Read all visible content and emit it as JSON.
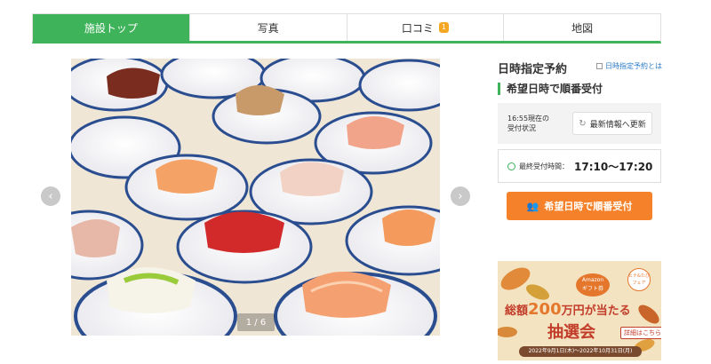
{
  "tabs": [
    {
      "label": "施設トップ",
      "active": true
    },
    {
      "label": "写真",
      "active": false
    },
    {
      "label": "口コミ",
      "badge": "1",
      "active": false
    },
    {
      "label": "地図",
      "active": false
    }
  ],
  "gallery": {
    "counter": "1 / 6",
    "prev_icon": "chevron-left-icon",
    "next_icon": "chevron-right-icon"
  },
  "reservation": {
    "title": "日時指定予約",
    "help_link": "日時指定予約とは",
    "subtitle": "希望日時で順番受付",
    "status_line1": "16:55現在の",
    "status_line2": "受付状況",
    "refresh_label": "最新情報へ更新",
    "last_time_label": "最終受付時間：",
    "last_time_value": "17:10〜17:20",
    "queue_button": "希望日時で順番受付"
  },
  "banner": {
    "amazon_line1": "Amazon",
    "amazon_line2": "ギフト券",
    "fair_line1": "ヒナ&たび",
    "fair_line2": "フェア",
    "headline_prefix": "総額",
    "headline_amount": "200",
    "headline_suffix": "万円が当たる",
    "main": "抽選会",
    "detail": "詳細はこちら",
    "dates": "2022年9月1日(木)〜2022年10月31日(月)"
  },
  "colors": {
    "green": "#3eb35a",
    "orange": "#f5822a",
    "badge": "#f5a623"
  }
}
